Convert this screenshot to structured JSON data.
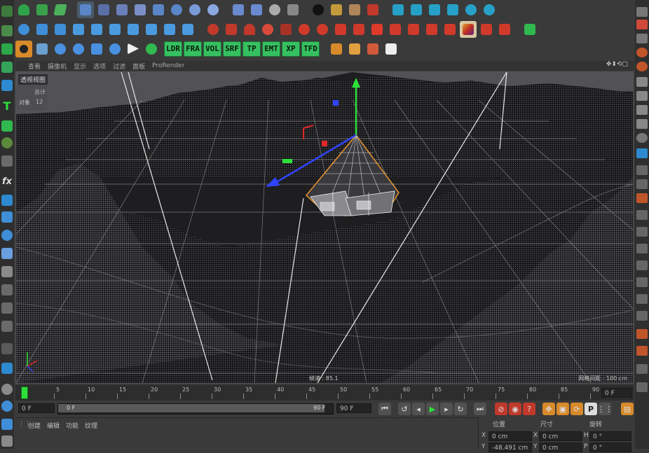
{
  "toolbar": {
    "row3_labels": [
      "LDR",
      "FRA",
      "VOL",
      "SRF",
      "TP",
      "EMT",
      "XP",
      "TFD"
    ]
  },
  "viewport": {
    "menu": [
      "查看",
      "摄像机",
      "显示",
      "选项",
      "过滤",
      "面板",
      "ProRender"
    ],
    "view_label": "透视视图",
    "stats_title": "总计",
    "stats_label": "对象",
    "stats_value": "12",
    "fps_text": "帧速 : 85.1",
    "grid_text": "网格间距 : 100 cm"
  },
  "timeline": {
    "ticks": [
      "0",
      "5",
      "10",
      "15",
      "20",
      "25",
      "30",
      "35",
      "40",
      "45",
      "50",
      "55",
      "60",
      "65",
      "70",
      "75",
      "80",
      "85",
      "90"
    ],
    "current_frame": "0 F"
  },
  "transport": {
    "start_field": "0 F",
    "range_start": "0 F",
    "range_end": "90 F",
    "end_field": "90 F"
  },
  "bottom": {
    "menu": [
      "创建",
      "编辑",
      "功能",
      "纹理"
    ],
    "coord_headers": [
      "位置",
      "尺寸",
      "旋转"
    ],
    "x_label": "X",
    "x_pos": "0 cm",
    "x_size_label": "X",
    "x_size": "0 cm",
    "h_label": "H",
    "h_rot": "0 °",
    "y_label": "Y",
    "y_pos": "-48.491 cm",
    "y_size_label": "Y",
    "y_size": "0 cm",
    "p_label": "P",
    "p_rot": "0 °"
  },
  "colors": {
    "accent_orange": "#e8932a",
    "axis_green": "#2ee03a",
    "axis_blue": "#3044ff",
    "axis_red": "#e02828",
    "plugin_green": "#36c061"
  }
}
